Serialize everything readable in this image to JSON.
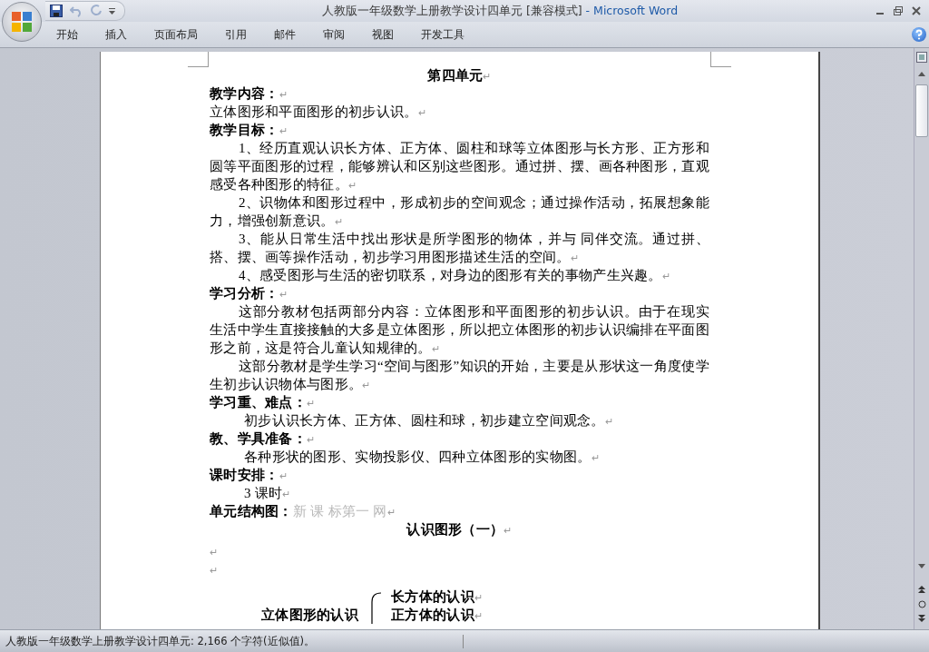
{
  "window": {
    "title": "人教版一年级数学上册教学设计四单元 [兼容模式]",
    "app_name": " - Microsoft Word"
  },
  "quick_access": [
    {
      "kind": "save",
      "disabled": false
    },
    {
      "kind": "undo",
      "disabled": true
    },
    {
      "kind": "redo",
      "disabled": true
    }
  ],
  "tabs": [
    {
      "label": "开始",
      "selected": false
    },
    {
      "label": "插入",
      "selected": false
    },
    {
      "label": "页面布局",
      "selected": false
    },
    {
      "label": "引用",
      "selected": false
    },
    {
      "label": "邮件",
      "selected": false
    },
    {
      "label": "审阅",
      "selected": false
    },
    {
      "label": "视图",
      "selected": false
    },
    {
      "label": "开发工具",
      "selected": false
    }
  ],
  "document": {
    "paragraph_mark": "↵",
    "blocks": [
      {
        "kind": "heading",
        "text": "第四单元"
      },
      {
        "kind": "label",
        "text": "教学内容："
      },
      {
        "kind": "plain",
        "text": "立体图形和平面图形的初步认识。"
      },
      {
        "kind": "label",
        "text": "教学目标："
      },
      {
        "kind": "para",
        "text": "1、经历直观认识长方体、正方体、圆柱和球等立体图形与长方形、正方形和圆等平面图形的过程，能够辨认和区别这些图形。通过拼、摆、画各种图形，直观感受各种图形的特征。"
      },
      {
        "kind": "para",
        "text": "2、识物体和图形过程中，形成初步的空间观念；通过操作活动，拓展想象能力，增强创新意识。"
      },
      {
        "kind": "para",
        "text": "3、能从日常生活中找出形状是所学图形的物体，并与 同伴交流。通过拼、搭、摆、画等操作活动，初步学习用图形描述生活的空间。"
      },
      {
        "kind": "para",
        "text": "4、感受图形与生活的密切联系，对身边的图形有关的事物产生兴趣。"
      },
      {
        "kind": "label",
        "text": "学习分析："
      },
      {
        "kind": "para",
        "text": "这部分教材包括两部分内容：立体图形和平面图形的初步认识。由于在现实生活中学生直接接触的大多是立体图形，所以把立体图形的初步认识编排在平面图形之前，这是符合儿童认知规律的。"
      },
      {
        "kind": "para",
        "text": "这部分教材是学生学习“空间与图形”知识的开始，主要是从形状这一角度使学生初步认识物体与图形。"
      },
      {
        "kind": "label",
        "text": "学习重、难点："
      },
      {
        "kind": "indented",
        "text": "初步认识长方体、正方体、圆柱和球，初步建立空间观念。"
      },
      {
        "kind": "label",
        "text": "教、学具准备："
      },
      {
        "kind": "indented",
        "text": "各种形状的图形、实物投影仪、四种立体图形的实物图。"
      },
      {
        "kind": "label",
        "text": "课时安排："
      },
      {
        "kind": "indented",
        "text": "3 课时"
      },
      {
        "kind": "label",
        "text": "单元结构图：",
        "faint": "新 课  标第一  网"
      },
      {
        "kind": "subheading",
        "text": "认识图形（一）"
      },
      {
        "kind": "empty"
      },
      {
        "kind": "empty"
      },
      {
        "kind": "diagram",
        "root": "立体图形的认识",
        "items": [
          "长方体的认识",
          "正方体的认识"
        ]
      }
    ]
  },
  "status_bar": {
    "text": "人教版一年级数学上册教学设计四单元: 2,166 个字符(近似值)。"
  }
}
